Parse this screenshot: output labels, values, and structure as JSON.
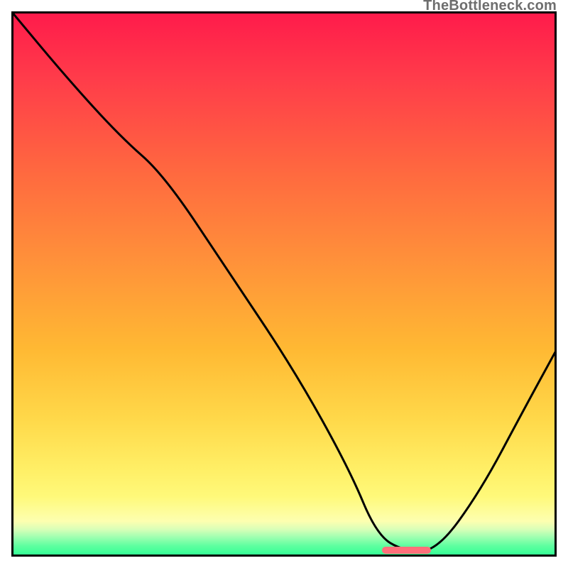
{
  "watermark": "TheBottleneck.com",
  "chart_data": {
    "type": "line",
    "title": "",
    "xlabel": "",
    "ylabel": "",
    "xlim": [
      0,
      100
    ],
    "ylim": [
      0,
      100
    ],
    "grid": false,
    "legend": false,
    "series": [
      {
        "name": "bottleneck-curve",
        "x": [
          0,
          10,
          20,
          28,
          40,
          52,
          62,
          67,
          72,
          78,
          86,
          94,
          100
        ],
        "y": [
          100,
          88,
          77,
          70,
          52,
          34,
          16,
          4,
          1,
          1,
          12,
          27,
          38
        ]
      }
    ],
    "marker": {
      "x_start": 68,
      "x_end": 77,
      "y": 0.5,
      "color": "#ff6f7a"
    },
    "background_gradient_stops": [
      {
        "pct": 0,
        "color": "#ff1a4b"
      },
      {
        "pct": 12,
        "color": "#ff3b4a"
      },
      {
        "pct": 30,
        "color": "#ff6a3f"
      },
      {
        "pct": 45,
        "color": "#ff8f3a"
      },
      {
        "pct": 62,
        "color": "#ffb933"
      },
      {
        "pct": 75,
        "color": "#ffd94a"
      },
      {
        "pct": 84,
        "color": "#ffef66"
      },
      {
        "pct": 89,
        "color": "#fff97a"
      },
      {
        "pct": 93.5,
        "color": "#fdffb0"
      },
      {
        "pct": 95,
        "color": "#d8ffb8"
      },
      {
        "pct": 96.5,
        "color": "#9cffb0"
      },
      {
        "pct": 98,
        "color": "#5fffa0"
      },
      {
        "pct": 100,
        "color": "#2cff93"
      }
    ]
  }
}
